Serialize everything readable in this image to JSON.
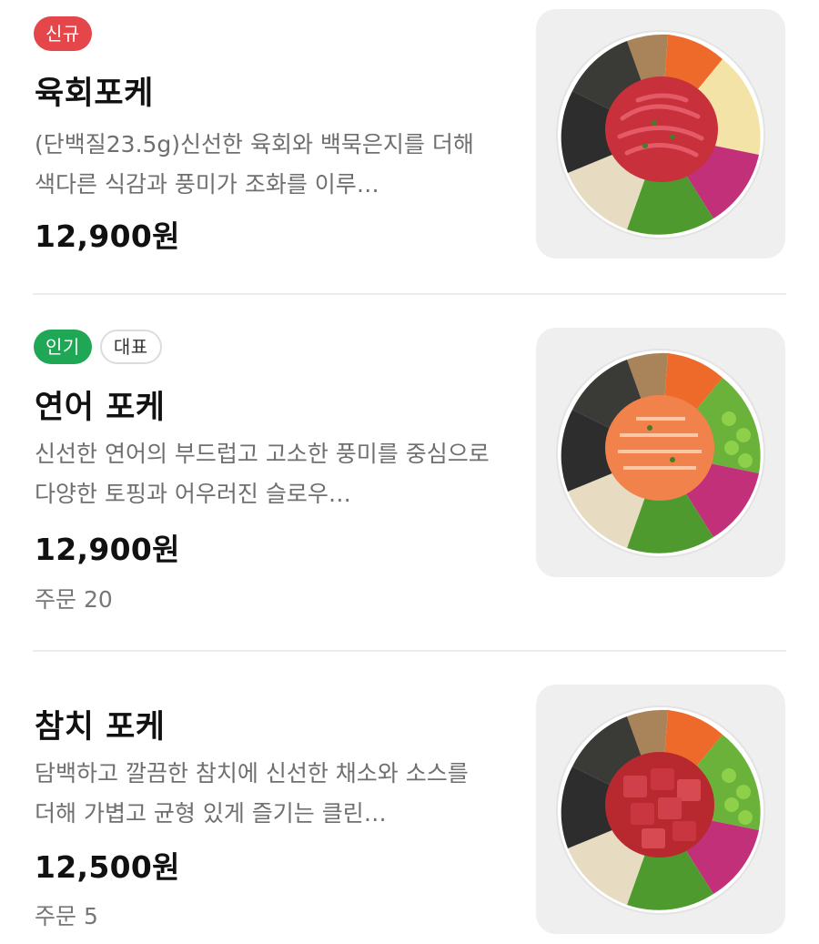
{
  "menu_items": [
    {
      "badges": [
        "신규"
      ],
      "name": "육회포케",
      "description": "(단백질23.5g)신선한 육회와 백묵은지를 더해 색다른 식감과 풍미가 조화를 이루…",
      "price": "12,900원",
      "image": "yukhoe-poke-bowl-image"
    },
    {
      "badges": [
        "인기",
        "대표"
      ],
      "name": "연어 포케",
      "description": "신선한 연어의 부드럽고 고소한 풍미를 중심으로 다양한 토핑과 어우러진 슬로우…",
      "price": "12,900원",
      "orders": "주문 20",
      "image": "salmon-poke-bowl-image"
    },
    {
      "badges": [],
      "name": "참치 포케",
      "description": "담백하고 깔끔한 참치에 신선한 채소와 소스를 더해 가볍고 균형 있게 즐기는 클린…",
      "price": "12,500원",
      "orders": "주문 5",
      "image": "tuna-poke-bowl-image"
    }
  ],
  "colors": {
    "badge_new": "#e4464a",
    "badge_popular": "#1fa756",
    "divider": "#ececec",
    "thumb_bg": "#efefef"
  }
}
